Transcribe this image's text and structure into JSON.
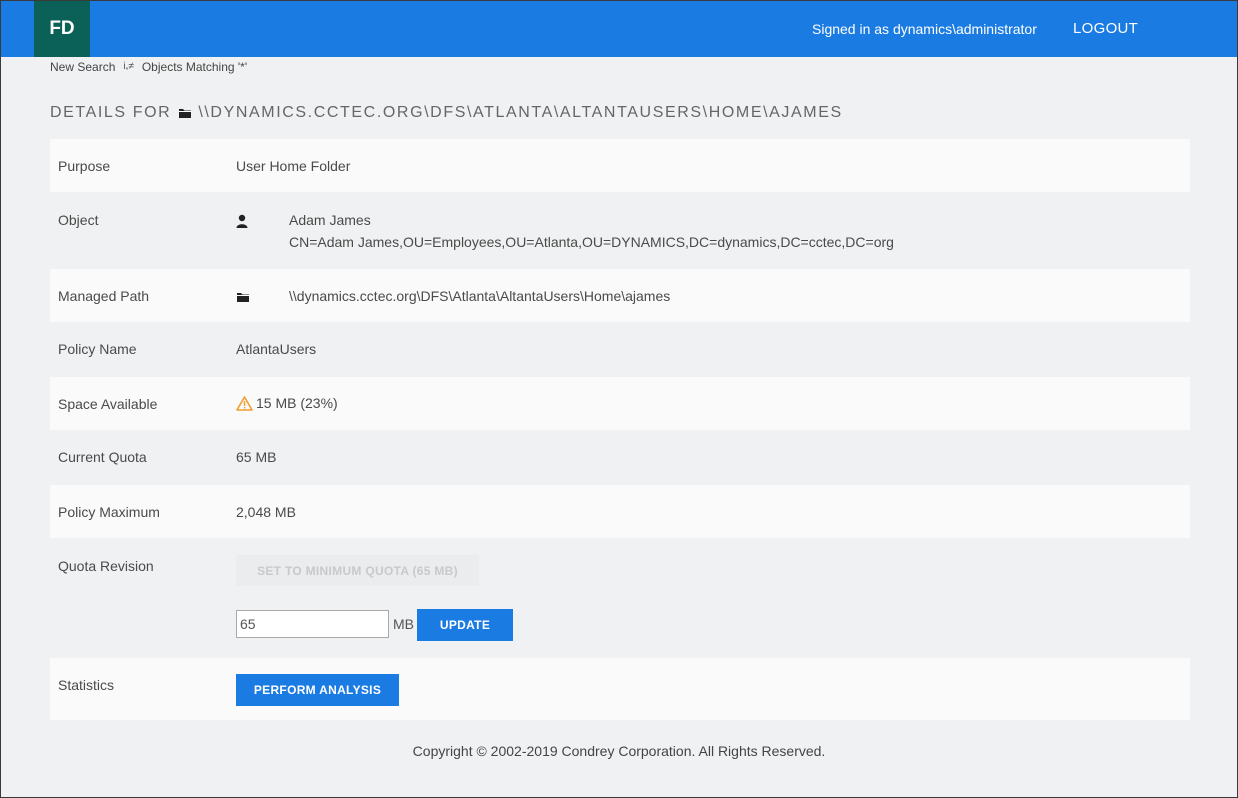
{
  "header": {
    "logo": "FD",
    "signed_in": "Signed in as dynamics\\administrator",
    "logout": "LOGOUT"
  },
  "breadcrumb": {
    "new_search": "New Search",
    "separator_icon": "filter-icon",
    "objects_matching": "Objects Matching '*'"
  },
  "details": {
    "heading_prefix": "DETAILS FOR",
    "heading_path": "\\\\DYNAMICS.CCTEC.ORG\\DFS\\ATLANTA\\ALTANTAUSERS\\HOME\\AJAMES",
    "rows": {
      "purpose": {
        "label": "Purpose",
        "value": "User Home Folder"
      },
      "object": {
        "label": "Object",
        "icon": "user-icon",
        "name": "Adam James",
        "dn": "CN=Adam James,OU=Employees,OU=Atlanta,OU=DYNAMICS,DC=dynamics,DC=cctec,DC=org"
      },
      "managed_path": {
        "label": "Managed Path",
        "icon": "folder-icon",
        "value": "\\\\dynamics.cctec.org\\DFS\\Atlanta\\AltantaUsers\\Home\\ajames"
      },
      "policy_name": {
        "label": "Policy Name",
        "value": "AtlantaUsers"
      },
      "space_available": {
        "label": "Space Available",
        "icon": "warning-icon",
        "value": "15 MB (23%)"
      },
      "current_quota": {
        "label": "Current Quota",
        "value": "65 MB"
      },
      "policy_maximum": {
        "label": "Policy Maximum",
        "value": "2,048 MB"
      },
      "quota_revision": {
        "label": "Quota Revision",
        "set_min_button": "SET TO MINIMUM QUOTA (65 MB)",
        "quota_value": "65",
        "unit": "MB",
        "update_button": "UPDATE"
      },
      "statistics": {
        "label": "Statistics",
        "analysis_button": "PERFORM ANALYSIS"
      }
    }
  },
  "footer": {
    "copyright": "Copyright © 2002-2019 Condrey Corporation. All Rights Reserved."
  },
  "colors": {
    "brand_blue": "#1a7be3",
    "logo_green": "#0b6157",
    "warning": "#f0a030"
  }
}
